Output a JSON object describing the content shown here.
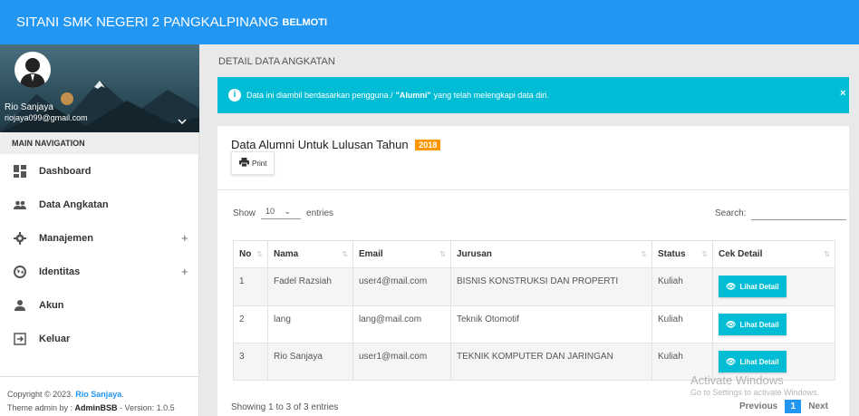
{
  "header": {
    "title": "SITANI SMK NEGERI 2 PANGKALPINANG",
    "subtitle": "BELMOTI"
  },
  "profile": {
    "name": "Rio Sanjaya",
    "email": "riojaya099@gmail.com"
  },
  "sidebar": {
    "nav_header": "MAIN NAVIGATION",
    "items": [
      {
        "label": "Dashboard",
        "icon": "dashboard-icon",
        "expandable": false
      },
      {
        "label": "Data Angkatan",
        "icon": "people-icon",
        "expandable": false
      },
      {
        "label": "Manajemen",
        "icon": "gear-icon",
        "expandable": true
      },
      {
        "label": "Identitas",
        "icon": "globe-icon",
        "expandable": true
      },
      {
        "label": "Akun",
        "icon": "user-icon",
        "expandable": false
      },
      {
        "label": "Keluar",
        "icon": "logout-icon",
        "expandable": false
      }
    ],
    "expand_symbol": "+",
    "footer": {
      "copyright_prefix": "Copyright © 2023.",
      "copyright_name": "Rio Sanjaya",
      "copyright_suffix": ".",
      "theme_prefix": "Theme admin by :",
      "theme_name": "AdminBSB",
      "version": "- Version: 1.0.5"
    }
  },
  "main": {
    "page_title": "DETAIL DATA ANGKATAN",
    "alert": {
      "prefix": "Data ini diambil berdasarkan pengguna /",
      "highlight": "\"Alumni\"",
      "suffix": "yang telah melengkapi data diri.",
      "close": "×"
    },
    "card": {
      "title": "Data Alumni Untuk Lulusan Tahun",
      "year": "2018",
      "print_label": "Print"
    },
    "table_controls": {
      "show_label": "Show",
      "entries_value": "10",
      "entries_label": "entries",
      "search_label": "Search:"
    },
    "table": {
      "columns": [
        "No",
        "Nama",
        "Email",
        "Jurusan",
        "Status",
        "Cek Detail"
      ],
      "rows": [
        {
          "no": "1",
          "nama": "Fadel Razsiah",
          "email": "user4@mail.com",
          "jurusan": "BISNIS KONSTRUKSI DAN PROPERTI",
          "status": "Kuliah",
          "action": "Lihat Detail"
        },
        {
          "no": "2",
          "nama": "lang",
          "email": "lang@mail.com",
          "jurusan": "Teknik Otomotif",
          "status": "Kuliah",
          "action": "Lihat Detail"
        },
        {
          "no": "3",
          "nama": "Rio Sanjaya",
          "email": "user1@mail.com",
          "jurusan": "TEKNIK KOMPUTER DAN JARINGAN",
          "status": "Kuliah",
          "action": "Lihat Detail"
        }
      ]
    },
    "footer": {
      "info": "Showing 1 to 3 of 3 entries",
      "previous": "Previous",
      "page": "1",
      "next": "Next"
    }
  },
  "watermark": {
    "line1": "Activate Windows",
    "line2": "Go to Settings to activate Windows."
  },
  "colors": {
    "primary": "#2196f3",
    "info": "#00bcd4",
    "badge": "#ff9800"
  }
}
